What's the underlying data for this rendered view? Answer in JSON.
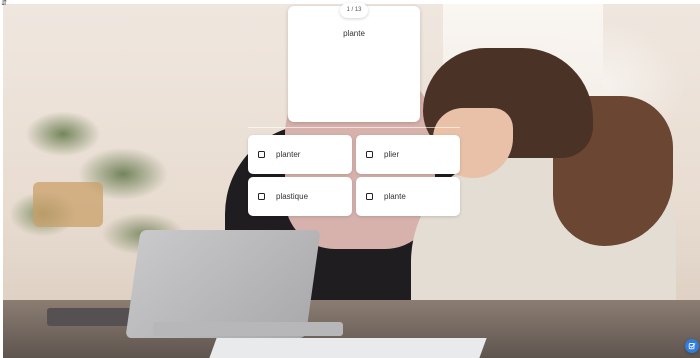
{
  "quiz": {
    "counter": "1 / 13",
    "prompt": "plante",
    "options": [
      {
        "label": "planter"
      },
      {
        "label": "plier"
      },
      {
        "label": "plastique"
      },
      {
        "label": "plante"
      }
    ]
  },
  "icons": {
    "corner": "sort-icon",
    "fab": "edit-check-icon"
  },
  "colors": {
    "card": "#ffffff",
    "fab": "#2f7de1"
  }
}
